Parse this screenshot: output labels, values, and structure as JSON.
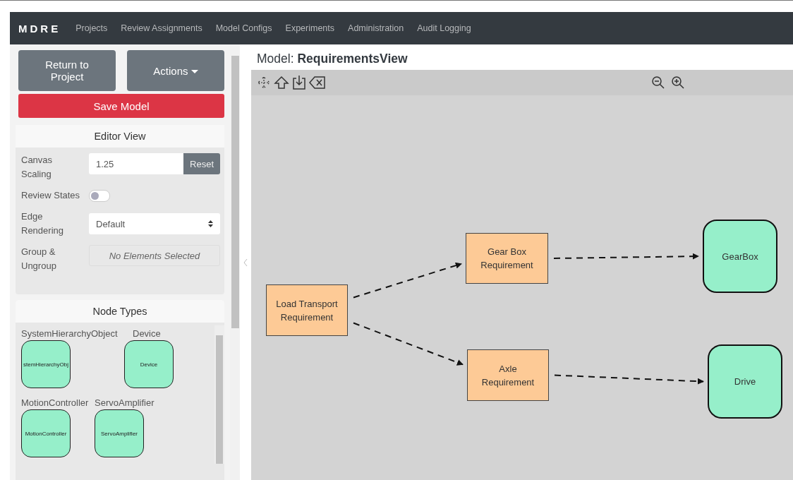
{
  "navbar": {
    "brand": "MDRE",
    "links": [
      "Projects",
      "Review Assignments",
      "Model Configs",
      "Experiments",
      "Administration",
      "Audit Logging"
    ]
  },
  "sidebar": {
    "return_button": "Return to Project",
    "actions_button": "Actions",
    "save_button": "Save Model",
    "editor_view": {
      "title": "Editor View",
      "canvas_scaling": {
        "label": "Canvas Scaling",
        "value": "1.25",
        "reset": "Reset"
      },
      "review_states": {
        "label": "Review States",
        "on": false
      },
      "edge_rendering": {
        "label": "Edge Rendering",
        "value": "Default"
      },
      "group": {
        "label": "Group & Ungroup",
        "value": "No Elements Selected"
      }
    },
    "node_types": {
      "title": "Node Types",
      "items": [
        {
          "name": "SystemHierarchyObject",
          "shape_label": "stemHierarchyObj"
        },
        {
          "name": "Device",
          "shape_label": "Device"
        },
        {
          "name": "MotionController",
          "shape_label": "MotionController"
        },
        {
          "name": "ServoAmplifier",
          "shape_label": "ServoAmplifier"
        }
      ]
    }
  },
  "model": {
    "label": "Model:",
    "name": "RequirementsView",
    "nodes": [
      {
        "kind": "requirement",
        "label": "Load Transport Requirement"
      },
      {
        "kind": "requirement",
        "label": "Gear Box Requirement"
      },
      {
        "kind": "requirement",
        "label": "Axle Requirement"
      },
      {
        "kind": "block",
        "label": "GearBox"
      },
      {
        "kind": "block",
        "label": "Drive"
      }
    ]
  }
}
